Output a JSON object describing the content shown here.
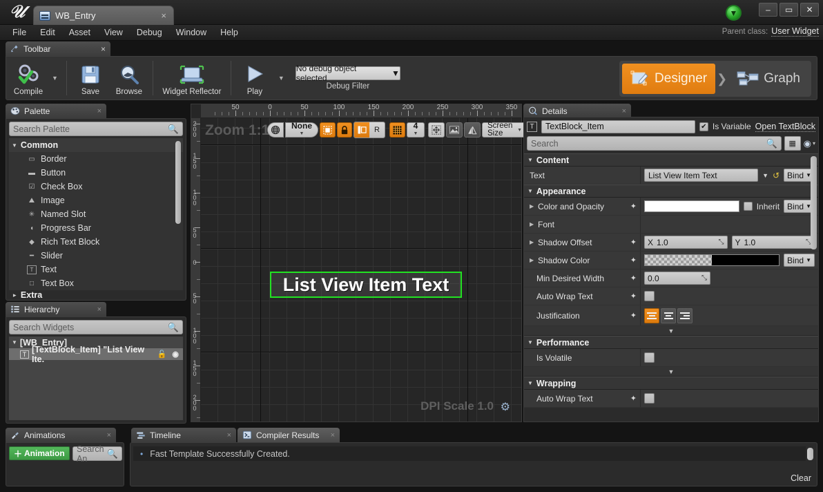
{
  "window": {
    "tab_title": "WB_Entry",
    "tab_close": "×",
    "minimize": "–",
    "maximize": "▭",
    "close": "✕"
  },
  "menu": {
    "items": [
      "File",
      "Edit",
      "Asset",
      "View",
      "Debug",
      "Window",
      "Help"
    ],
    "parent_class_label": "Parent class:",
    "parent_class_value": "User Widget"
  },
  "toolbar": {
    "tab_label": "Toolbar",
    "tab_close": "×",
    "compile": "Compile",
    "save": "Save",
    "browse": "Browse",
    "widget_reflector": "Widget Reflector",
    "play": "Play",
    "debug_object": "No debug object selected",
    "debug_filter_caption": "Debug Filter",
    "mode_designer": "Designer",
    "mode_graph": "Graph",
    "mode_separator": "❯"
  },
  "palette": {
    "tab_label": "Palette",
    "tab_close": "×",
    "search_placeholder": "Search Palette",
    "group_common": "Common",
    "group_extra": "Extra",
    "items": [
      {
        "label": "Border",
        "icon": "border-icon",
        "glyph": "▭"
      },
      {
        "label": "Button",
        "icon": "button-icon",
        "glyph": "▬"
      },
      {
        "label": "Check Box",
        "icon": "checkbox-icon",
        "glyph": "☑"
      },
      {
        "label": "Image",
        "icon": "image-icon",
        "glyph": "⛰"
      },
      {
        "label": "Named Slot",
        "icon": "named-slot-icon",
        "glyph": "✳"
      },
      {
        "label": "Progress Bar",
        "icon": "progress-bar-icon",
        "glyph": "◖"
      },
      {
        "label": "Rich Text Block",
        "icon": "rich-text-block-icon",
        "glyph": "◆"
      },
      {
        "label": "Slider",
        "icon": "slider-icon",
        "glyph": "━"
      },
      {
        "label": "Text",
        "icon": "text-icon",
        "glyph": "T"
      },
      {
        "label": "Text Box",
        "icon": "text-box-icon",
        "glyph": "□"
      }
    ]
  },
  "hierarchy": {
    "tab_label": "Hierarchy",
    "tab_close": "×",
    "search_placeholder": "Search Widgets",
    "root": "[WB_Entry]",
    "child_label": "[TextBlock_Item] \"List View Ite.",
    "child_icon": "T",
    "lock_icon": "🔓",
    "eye_icon": "◉"
  },
  "designer": {
    "zoom_label": "Zoom 1:1",
    "dpi_label": "DPI Scale 1.0",
    "dpi_gear": "⚙",
    "ruler_h_labels": [
      "50",
      "0",
      "50",
      "100",
      "150",
      "200",
      "250",
      "300",
      "350"
    ],
    "ruler_h_values": [
      -50,
      0,
      50,
      100,
      150,
      200,
      250,
      300,
      350
    ],
    "ruler_v_labels": [
      "200",
      "150",
      "100",
      "50",
      "0",
      "50",
      "100",
      "150",
      "200"
    ],
    "ruler_v_values": [
      -200,
      -150,
      -100,
      -50,
      0,
      50,
      100,
      150,
      200
    ],
    "toolbar": {
      "localization": "🌐",
      "none_label": "None",
      "dashed_outline": "▢",
      "lock_icon": "🔒",
      "layout_icon": "▌",
      "r_label": "R",
      "grid_icon": "▦",
      "grid_size": "4",
      "fit_icon": "✥",
      "image_icon": "🏞",
      "mirror_icon": "◧",
      "screen_size": "Screen Size"
    },
    "widget_text": "List View Item Text"
  },
  "details": {
    "tab_label": "Details",
    "tab_close": "×",
    "widget_name": "TextBlock_Item",
    "widget_icon": "T",
    "is_variable_label": "Is Variable",
    "is_variable_checked": true,
    "open_textblock": "Open TextBlock",
    "search_placeholder": "Search",
    "grid_view_icon": "▦",
    "eye_icon": "◉",
    "caret_icon": "▾",
    "sections": {
      "content": {
        "title": "Content",
        "rows": [
          {
            "label": "Text",
            "value": "List View Item Text",
            "bind": "Bind",
            "type": "text-combo"
          }
        ]
      },
      "appearance": {
        "title": "Appearance",
        "rows": [
          {
            "label": "Color and Opacity",
            "type": "color",
            "color": "#ffffff",
            "inherit_label": "Inherit",
            "inherit_checked": false,
            "bind": "Bind"
          },
          {
            "label": "Font",
            "type": "expandable"
          },
          {
            "label": "Shadow Offset",
            "type": "vector2",
            "x_axis": "X",
            "x": "1.0",
            "y_axis": "Y",
            "y": "1.0"
          },
          {
            "label": "Shadow Color",
            "type": "color-alpha",
            "color": "#000000",
            "bind": "Bind"
          },
          {
            "label": "Min Desired Width",
            "type": "number",
            "value": "0.0"
          },
          {
            "label": "Auto Wrap Text",
            "type": "checkbox",
            "checked": false
          },
          {
            "label": "Justification",
            "type": "buttongroup",
            "options": [
              "left",
              "center",
              "right"
            ],
            "selected": "left"
          }
        ]
      },
      "performance": {
        "title": "Performance",
        "rows": [
          {
            "label": "Is Volatile",
            "type": "checkbox",
            "checked": false
          }
        ]
      },
      "wrapping": {
        "title": "Wrapping",
        "rows": [
          {
            "label": "Auto Wrap Text",
            "type": "checkbox",
            "checked": false
          }
        ]
      }
    }
  },
  "animations": {
    "tab_label": "Animations",
    "tab_close": "×",
    "add_button": "Animation",
    "add_plus": "＋",
    "search_placeholder": "Search An"
  },
  "bottom": {
    "timeline_tab": "Timeline",
    "timeline_close": "×",
    "compiler_tab": "Compiler Results",
    "compiler_close": "×",
    "log_message": "Fast Template Successfully Created.",
    "log_bullet": "•",
    "clear_label": "Clear"
  },
  "colors": {
    "accent_orange": "#ef8f1f",
    "selection_green": "#22e222",
    "add_green": "#3d9a44",
    "panel_bg": "#2b2b2b"
  }
}
